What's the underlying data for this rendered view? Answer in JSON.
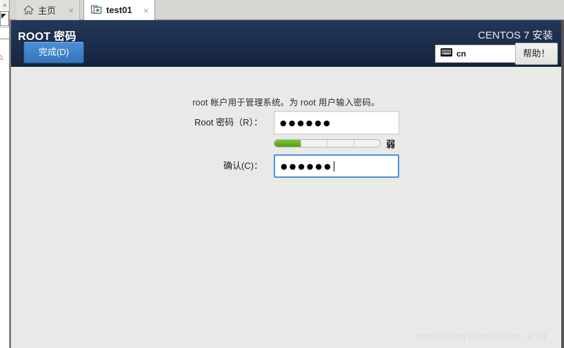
{
  "host": {
    "sliver": {
      "chevron": "»",
      "number": "0",
      "number_dot": "."
    },
    "tabs": [
      {
        "label": "主页",
        "icon": "home-icon",
        "close": "×",
        "active": false
      },
      {
        "label": "test01",
        "icon": "virtual-machine-icon",
        "close": "×",
        "active": true
      }
    ]
  },
  "installer": {
    "page_title": "ROOT 密码",
    "done_label": "完成(D)",
    "product_title": "CENTOS 7 安装",
    "keyboard": {
      "icon": "keyboard-icon",
      "language": "cn"
    },
    "help_label": "帮助！",
    "hint": "root 帐户用于管理系统。为 root 用户输入密码。",
    "fields": {
      "password": {
        "label": "Root 密码（R）：",
        "value": "●●●●●●",
        "placeholder": "",
        "focused": false
      },
      "confirm": {
        "label": "确认(C)：",
        "value": "●●●●●●",
        "placeholder": "",
        "focused": true
      }
    },
    "strength": {
      "label": "弱",
      "segments_total": 4,
      "segments_filled": 1,
      "fill_color": "#5ca513"
    },
    "colors": {
      "header_navy": "#1d3050",
      "accent_blue": "#4a90d9",
      "done_button_blue": "#3f82c8",
      "body_gray": "#e9e9e7"
    }
  },
  "watermark": "https://blog.csdn.net/ws_kfxd"
}
